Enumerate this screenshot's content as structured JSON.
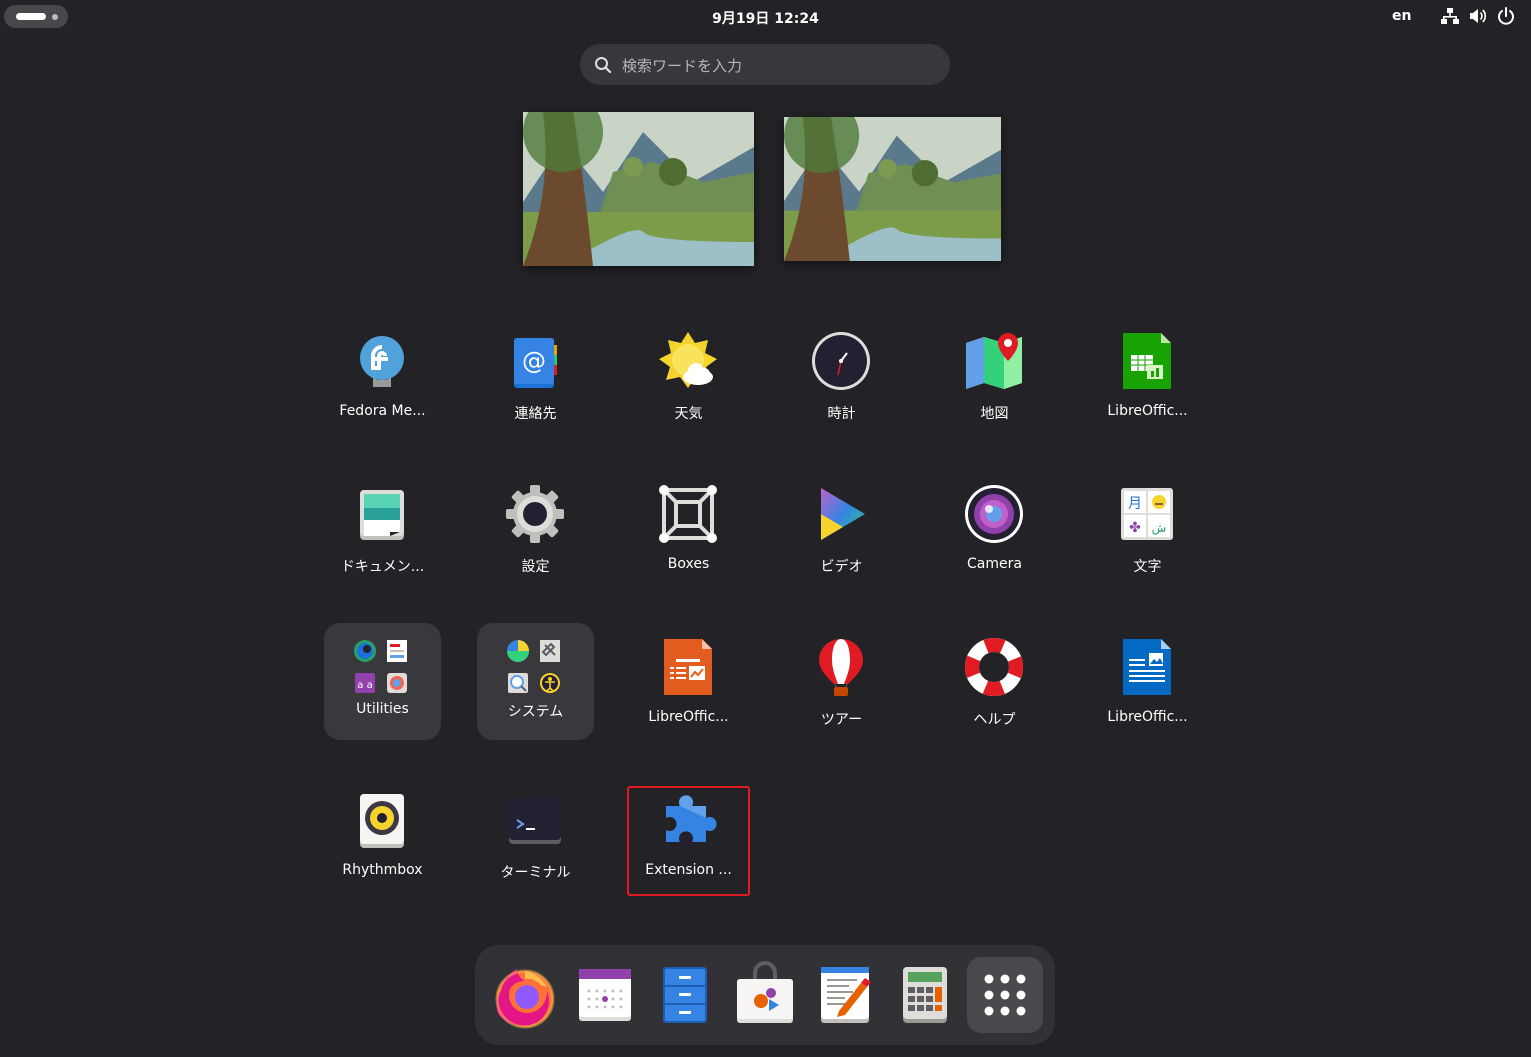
{
  "topbar": {
    "clock": "9月19日  12:24",
    "language": "en",
    "icons": [
      "network-icon",
      "volume-icon",
      "power-icon"
    ]
  },
  "search": {
    "placeholder": "検索ワードを入力"
  },
  "apps": [
    {
      "label": "Fedora Me...",
      "icon": "fedora-media-writer-icon"
    },
    {
      "label": "連絡先",
      "icon": "contacts-icon"
    },
    {
      "label": "天気",
      "icon": "weather-icon"
    },
    {
      "label": "時計",
      "icon": "clock-icon"
    },
    {
      "label": "地図",
      "icon": "maps-icon"
    },
    {
      "label": "LibreOffic...",
      "icon": "libreoffice-calc-icon"
    },
    {
      "label": "ドキュメン...",
      "icon": "document-scanner-icon"
    },
    {
      "label": "設定",
      "icon": "settings-gear-icon"
    },
    {
      "label": "Boxes",
      "icon": "boxes-icon"
    },
    {
      "label": "ビデオ",
      "icon": "videos-icon"
    },
    {
      "label": "Camera",
      "icon": "camera-icon"
    },
    {
      "label": "文字",
      "icon": "characters-icon"
    },
    {
      "label": "Utilities",
      "icon": "utilities-folder-icon"
    },
    {
      "label": "システム",
      "icon": "system-folder-icon"
    },
    {
      "label": "LibreOffic...",
      "icon": "libreoffice-impress-icon"
    },
    {
      "label": "ツアー",
      "icon": "tour-balloon-icon"
    },
    {
      "label": "ヘルプ",
      "icon": "help-lifebuoy-icon"
    },
    {
      "label": "LibreOffic...",
      "icon": "libreoffice-writer-icon"
    },
    {
      "label": "Rhythmbox",
      "icon": "rhythmbox-speaker-icon"
    },
    {
      "label": "ターミナル",
      "icon": "terminal-icon"
    },
    {
      "label": "Extension ...",
      "icon": "extension-puzzle-icon"
    }
  ],
  "dash": {
    "items": [
      "firefox-icon",
      "calendar-icon",
      "files-icon",
      "software-icon",
      "text-editor-icon",
      "calculator-icon",
      "show-apps-grid-icon"
    ]
  },
  "colors": {
    "background": "#232327",
    "folder": "#38383d",
    "dash": "#323236",
    "selection": "#e01b24"
  }
}
